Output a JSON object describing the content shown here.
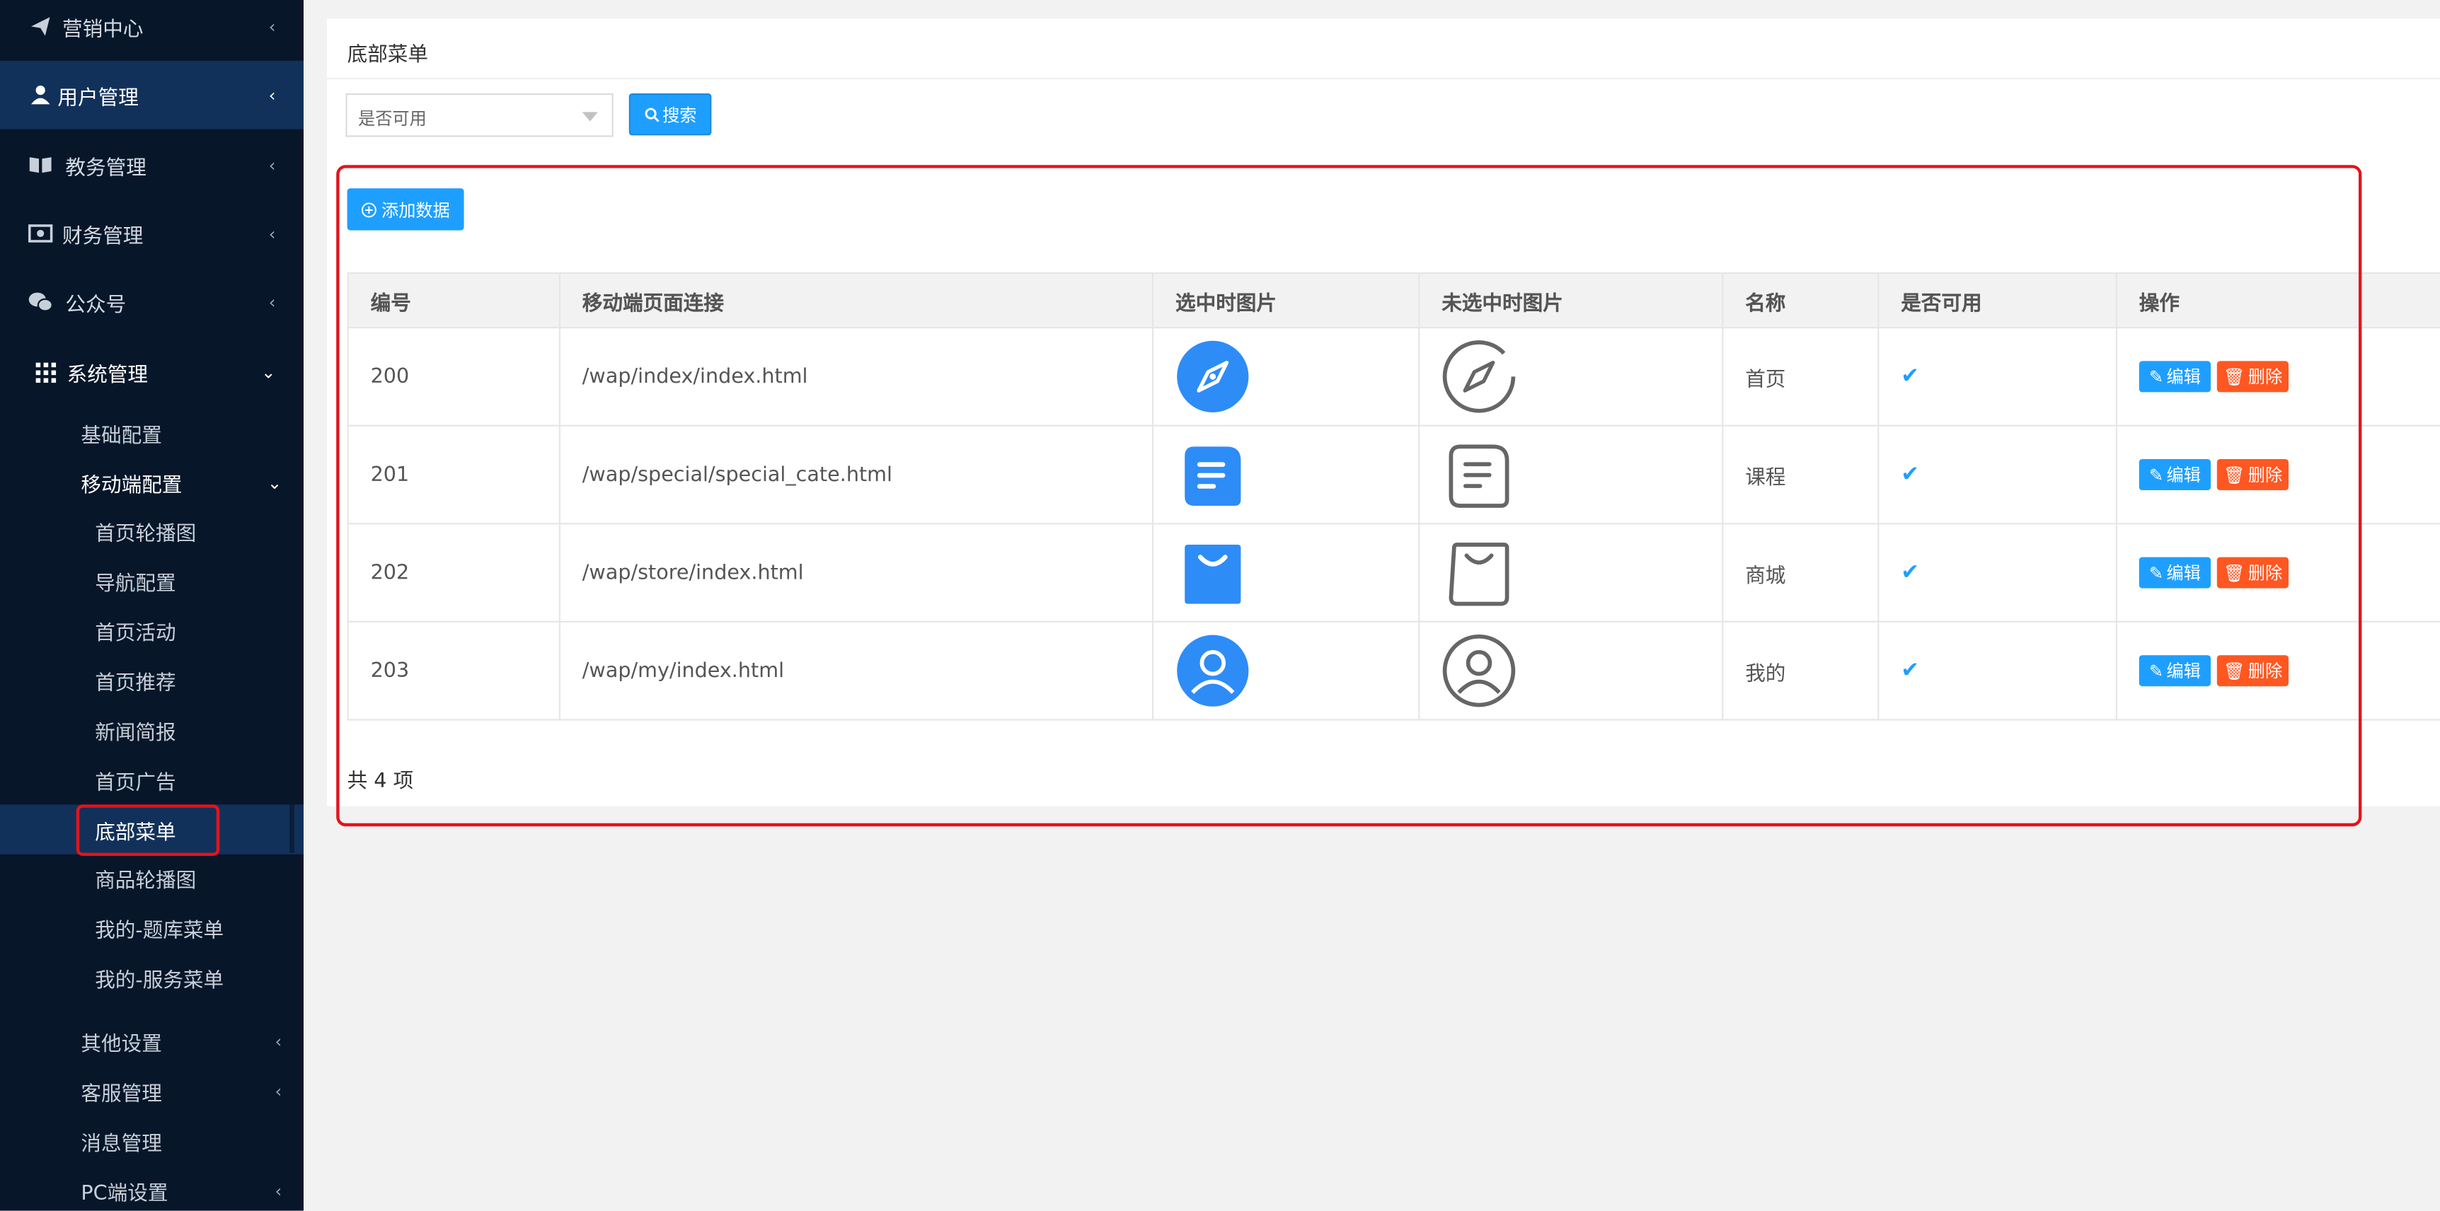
{
  "sidebar": {
    "marketing": "营销中心",
    "users": "用户管理",
    "academic": "教务管理",
    "finance": "财务管理",
    "wechat": "公众号",
    "system": "系统管理",
    "basic_config": "基础配置",
    "mobile_config": "移动端配置",
    "leaves": [
      "首页轮播图",
      "导航配置",
      "首页活动",
      "首页推荐",
      "新闻简报",
      "首页广告",
      "底部菜单",
      "商品轮播图",
      "我的-题库菜单",
      "我的-服务菜单"
    ],
    "other_settings": "其他设置",
    "customer_service": "客服管理",
    "messages": "消息管理",
    "pc_settings": "PC端设置"
  },
  "page": {
    "title": "底部菜单",
    "filter_placeholder": "是否可用",
    "search_label": "搜索",
    "add_label": "添加数据",
    "total": "共 4 项"
  },
  "table": {
    "headers": [
      "编号",
      "移动端页面连接",
      "选中时图片",
      "未选中时图片",
      "名称",
      "是否可用",
      "操作"
    ],
    "rows": [
      {
        "id": "200",
        "link": "/wap/index/index.html",
        "name": "首页",
        "selected_icon": "compass-icon",
        "unselected_icon": "compass-outline-icon"
      },
      {
        "id": "201",
        "link": "/wap/special/special_cate.html",
        "name": "课程",
        "selected_icon": "document-icon",
        "unselected_icon": "document-outline-icon"
      },
      {
        "id": "202",
        "link": "/wap/store/index.html",
        "name": "商城",
        "selected_icon": "bag-icon",
        "unselected_icon": "bag-outline-icon"
      },
      {
        "id": "203",
        "link": "/wap/my/index.html",
        "name": "我的",
        "selected_icon": "user-icon",
        "unselected_icon": "user-outline-icon"
      }
    ],
    "edit_label": "编辑",
    "delete_label": "删除"
  },
  "colors": {
    "primary": "#1e9fff",
    "danger": "#ff5722",
    "sidebar": "#071629",
    "highlight": "#e3141c"
  }
}
